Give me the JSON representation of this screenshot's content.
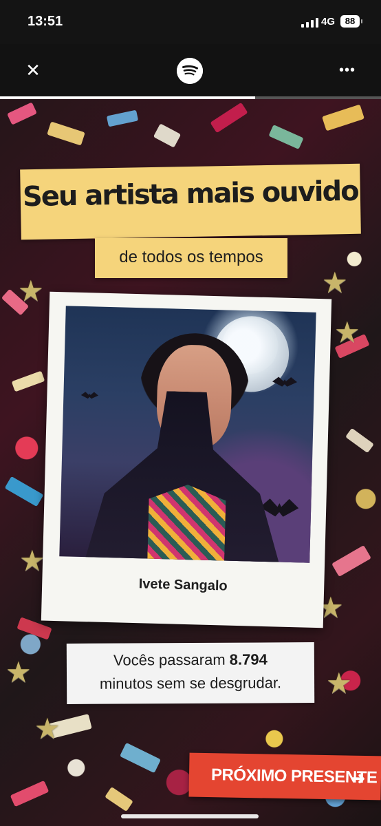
{
  "status_bar": {
    "time": "13:51",
    "network": "4G",
    "battery": "88"
  },
  "top_bar": {
    "close_icon": "close-icon",
    "logo_icon": "spotify-icon",
    "more_icon": "more-icon"
  },
  "story": {
    "progress": 0.67,
    "title": "Seu artista mais ouvido",
    "subtitle": "de todos os tempos",
    "artist_name": "Ivete Sangalo",
    "minutes_line1_prefix": "Vocês passaram",
    "minutes_value": "8.794",
    "minutes_line2": "minutos sem se desgrudar.",
    "next_button": "PRÓXIMO PRESENTE",
    "next_arrow_icon": "arrow-right-icon"
  },
  "colors": {
    "accent_yellow": "#f5d47b",
    "button_red": "#e44531"
  }
}
